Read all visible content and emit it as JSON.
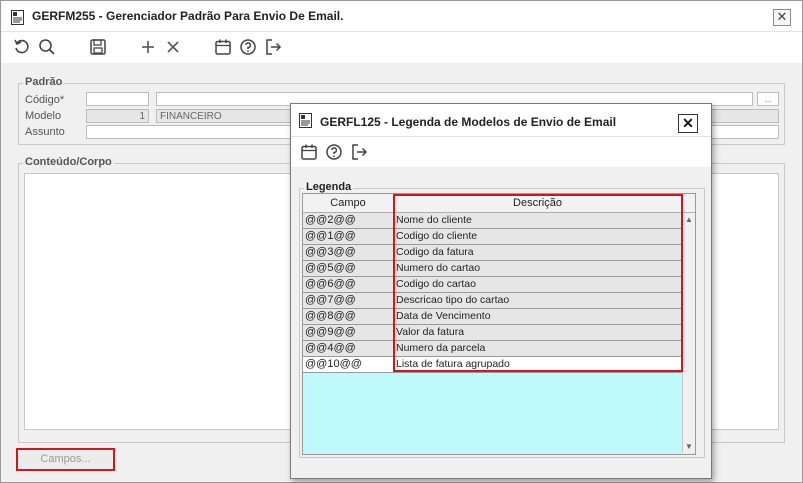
{
  "window": {
    "title": "GERFM255 - Gerenciador Padrão Para Envio De Email.",
    "close_label": "✕"
  },
  "toolbar": {
    "icons": [
      "undo-icon",
      "search-icon",
      "save-icon",
      "add-icon",
      "delete-icon",
      "calendar-icon",
      "help-icon",
      "exit-icon"
    ]
  },
  "padrao": {
    "legend": "Padrão",
    "codigo_label": "Código*",
    "modelo_label": "Modelo",
    "modelo_value": "1",
    "modelo_name": "FINANCEIRO",
    "assunto_label": "Assunto",
    "lookup_label": "..."
  },
  "conteudo": {
    "legend": "Conteúdo/Corpo"
  },
  "campos_button": "Campos...",
  "dialog": {
    "title": "GERFL125 - Legenda de Modelos de Envio de Email",
    "close_label": "✕",
    "legend": "Legenda",
    "columns": {
      "campo": "Campo",
      "descricao": "Descrição"
    },
    "rows": [
      {
        "campo": "@@2@@",
        "descricao": "Nome do cliente"
      },
      {
        "campo": "@@1@@",
        "descricao": "Codigo do cliente"
      },
      {
        "campo": "@@3@@",
        "descricao": "Codigo da fatura"
      },
      {
        "campo": "@@5@@",
        "descricao": "Numero do cartao"
      },
      {
        "campo": "@@6@@",
        "descricao": "Codigo do cartao"
      },
      {
        "campo": "@@7@@",
        "descricao": "Descricao tipo do cartao"
      },
      {
        "campo": "@@8@@",
        "descricao": "Data de Vencimento"
      },
      {
        "campo": "@@9@@",
        "descricao": "Valor da fatura"
      },
      {
        "campo": "@@4@@",
        "descricao": "Numero da parcela"
      },
      {
        "campo": "@@10@@",
        "descricao": "Lista de fatura agrupado"
      }
    ]
  },
  "colors": {
    "highlight": "#d0171b",
    "grid_bg": "#bff9fb",
    "row_bg": "#e6e6e6"
  }
}
